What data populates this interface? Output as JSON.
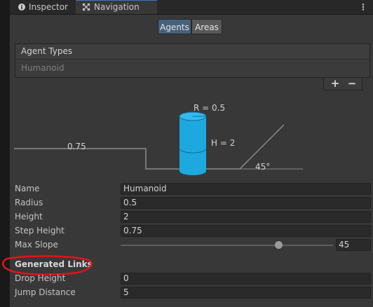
{
  "tabs": [
    {
      "label": "Inspector",
      "icon": "info-icon"
    },
    {
      "label": "Navigation",
      "icon": "navigation-icon",
      "active": true
    }
  ],
  "toolbar": {
    "agents_label": "Agents",
    "areas_label": "Areas",
    "selected": "Agents"
  },
  "agent_types": {
    "title": "Agent Types",
    "items": [
      "Humanoid"
    ],
    "add_label": "+",
    "remove_label": "−"
  },
  "diagram": {
    "radius_label": "R = 0.5",
    "height_label": "H = 2",
    "step_label": "0.75",
    "slope_label": "45°"
  },
  "properties": {
    "name": {
      "label": "Name",
      "value": "Humanoid"
    },
    "radius": {
      "label": "Radius",
      "value": "0.5"
    },
    "height": {
      "label": "Height",
      "value": "2"
    },
    "step_height": {
      "label": "Step Height",
      "value": "0.75"
    },
    "max_slope": {
      "label": "Max Slope",
      "value": "45",
      "min": 0,
      "max": 60
    }
  },
  "generated_links": {
    "title": "Generated Links",
    "drop_height": {
      "label": "Drop Height",
      "value": "0"
    },
    "jump_distance": {
      "label": "Jump Distance",
      "value": "5"
    }
  },
  "colors": {
    "accent": "#3a79bb",
    "agent_cylinder": "#1ea8e0",
    "annotation": "#e0141c"
  }
}
